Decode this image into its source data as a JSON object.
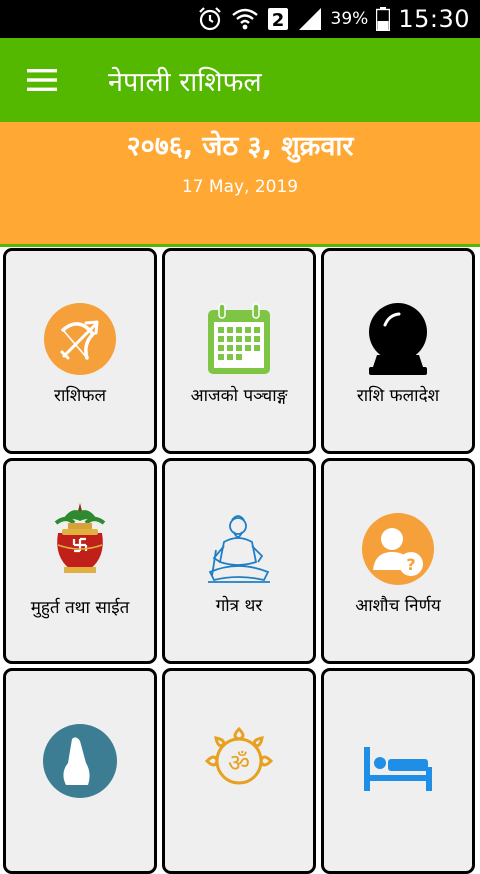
{
  "status_bar": {
    "sim_badge": "2",
    "battery_percent": "39%",
    "time": "15:30"
  },
  "app_bar": {
    "title": "नेपाली राशिफल"
  },
  "date_banner": {
    "nepali_date": "२०७६, जेठ ३, शुक्रवार",
    "english_date": "17 May, 2019"
  },
  "tiles": [
    {
      "label": "राशिफल",
      "icon": "sagittarius-bow-icon"
    },
    {
      "label": "आजको पञ्चाङ्ग",
      "icon": "calendar-icon"
    },
    {
      "label": "राशि फलादेश",
      "icon": "crystal-ball-icon"
    },
    {
      "label": "मुहुर्त तथा साईत",
      "icon": "kalash-icon"
    },
    {
      "label": "गोत्र थर",
      "icon": "sage-icon"
    },
    {
      "label": "आशौच निर्णय",
      "icon": "user-question-icon"
    },
    {
      "label": "",
      "icon": "praying-hands-icon"
    },
    {
      "label": "",
      "icon": "om-icon"
    },
    {
      "label": "",
      "icon": "bed-icon"
    }
  ],
  "colors": {
    "app_bar": "#54b700",
    "date_banner": "#ffa833",
    "tile_bg": "#efefef",
    "orange_icon": "#f5a03a",
    "calendar_green": "#7fc545",
    "teal_icon": "#3d7d94",
    "blue_icon": "#1e8ee6"
  }
}
